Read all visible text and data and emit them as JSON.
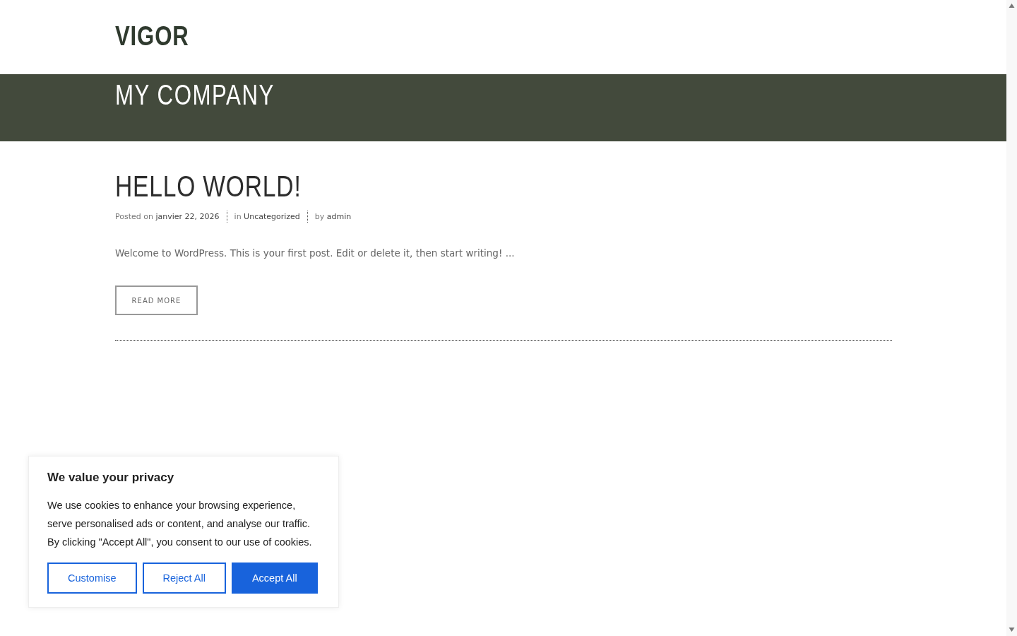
{
  "header": {
    "logo": "VIGOR"
  },
  "hero": {
    "title": "MY COMPANY"
  },
  "post": {
    "title": "HELLO WORLD!",
    "meta": [
      {
        "prefix": "Posted on",
        "value": "janvier 22, 2026"
      },
      {
        "prefix": "in",
        "value": "Uncategorized"
      },
      {
        "prefix": "by",
        "value": "admin"
      }
    ],
    "excerpt": "Welcome to WordPress. This is your first post. Edit or delete it, then start writing! ...",
    "button": "READ MORE"
  },
  "cookie_banner": {
    "title": "We value your privacy",
    "text": "We use cookies to enhance your browsing experience, serve personalised ads or content, and analyse our traffic. By clicking \"Accept All\", you consent to our use of cookies.",
    "buttons": [
      {
        "label": "Customise",
        "kind": "outline"
      },
      {
        "label": "Reject All",
        "kind": "outline"
      },
      {
        "label": "Accept All",
        "kind": "primary"
      }
    ]
  }
}
